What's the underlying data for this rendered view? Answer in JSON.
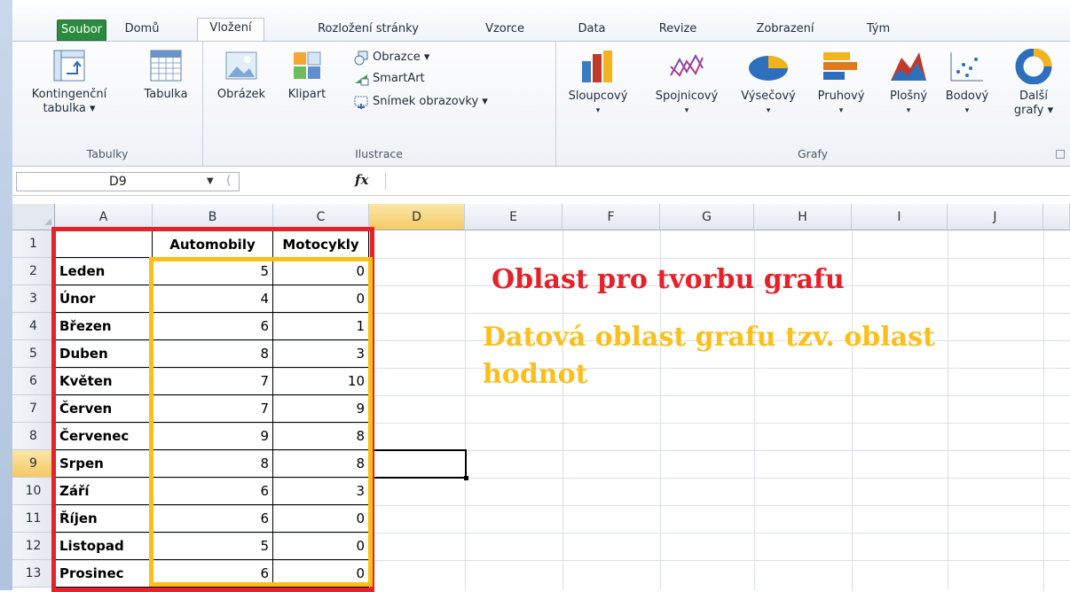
{
  "tabs": [
    "Soubor",
    "Domů",
    "Vložení",
    "Rozložení stránky",
    "Vzorce",
    "Data",
    "Revize",
    "Zobrazení",
    "Tým"
  ],
  "active_tab": "Vložení",
  "ribbon": {
    "groups": {
      "tables": "Tabulky",
      "illustrations": "Ilustrace",
      "charts": "Grafy"
    },
    "buttons": {
      "pivot_line1": "Kontingenční",
      "pivot_line2": "tabulka ▾",
      "table": "Tabulka",
      "picture": "Obrázek",
      "clipart": "Klipart",
      "shapes": "Obrazce ▾",
      "smartart": "SmartArt",
      "screenshot": "Snímek obrazovky ▾",
      "column": "Sloupcový",
      "line": "Spojnicový",
      "pie": "Výsečový",
      "bar": "Pruhový",
      "area": "Plošný",
      "scatter": "Bodový",
      "other_line1": "Další",
      "other_line2": "grafy ▾"
    }
  },
  "formula_bar": {
    "name_box": "D9",
    "fx": "fx",
    "content": ""
  },
  "columns": [
    "A",
    "B",
    "C",
    "D",
    "E",
    "F",
    "G",
    "H",
    "I",
    "J"
  ],
  "rows": [
    "1",
    "2",
    "3",
    "4",
    "5",
    "6",
    "7",
    "8",
    "9",
    "10",
    "11",
    "12",
    "13"
  ],
  "table": {
    "header": [
      "",
      "Automobily",
      "Motocykly"
    ],
    "rows": [
      [
        "Leden",
        "5",
        "0"
      ],
      [
        "Únor",
        "4",
        "0"
      ],
      [
        "Březen",
        "6",
        "1"
      ],
      [
        "Duben",
        "8",
        "3"
      ],
      [
        "Květen",
        "7",
        "10"
      ],
      [
        "Červen",
        "7",
        "9"
      ],
      [
        "Červenec",
        "9",
        "8"
      ],
      [
        "Srpen",
        "8",
        "8"
      ],
      [
        "Září",
        "6",
        "3"
      ],
      [
        "Říjen",
        "6",
        "0"
      ],
      [
        "Listopad",
        "5",
        "0"
      ],
      [
        "Prosinec",
        "6",
        "0"
      ]
    ]
  },
  "annotations": {
    "red_text": "Oblast pro tvorbu grafu",
    "yellow_text": "Datová oblast grafu tzv. oblast hodnot",
    "red_color": "#e8202a",
    "yellow_color": "#fcbf1a"
  },
  "colors": {
    "file_tab": "#2a8b3f",
    "selected_header": "#f5c965"
  }
}
